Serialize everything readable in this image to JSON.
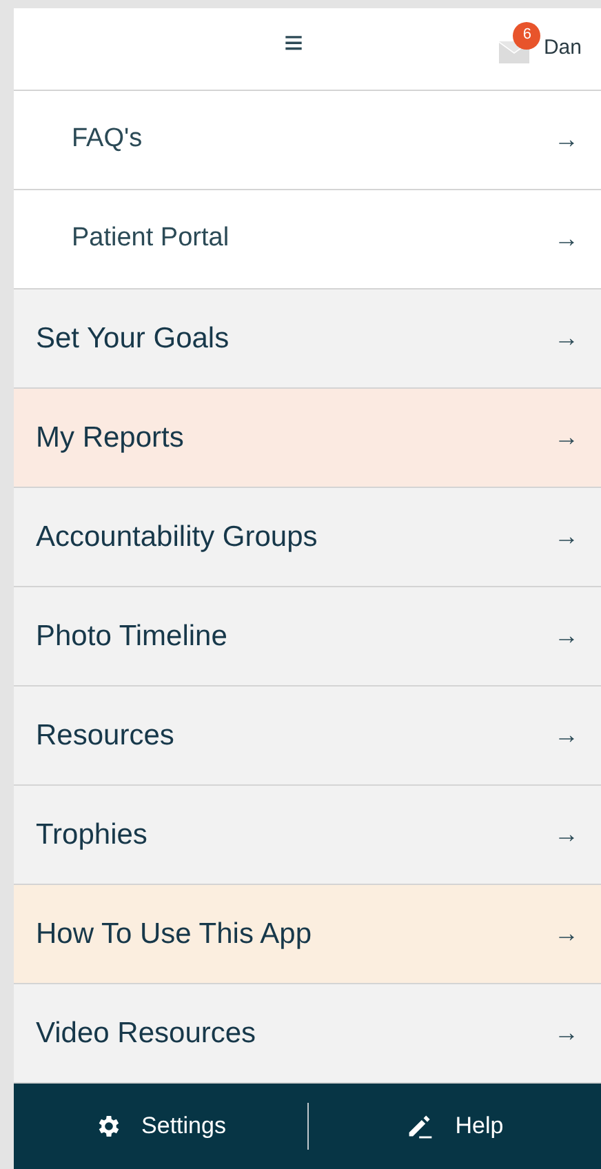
{
  "header": {
    "menu_label": "≡",
    "unread_count": "6",
    "user_name": "Dan"
  },
  "menu_items": [
    {
      "label": "FAQ's",
      "kind": "sub",
      "color": "#ffffff",
      "arrow": "→"
    },
    {
      "label": "Patient Portal",
      "kind": "sub",
      "color": "#ffffff",
      "arrow": "→"
    },
    {
      "label": "Set Your Goals",
      "kind": "main",
      "color": "#f2f2f2",
      "arrow": "→"
    },
    {
      "label": "My Reports",
      "kind": "main",
      "color": "#fbeae1",
      "arrow": "→"
    },
    {
      "label": "Accountability Groups",
      "kind": "main",
      "color": "#f2f2f2",
      "arrow": "→"
    },
    {
      "label": "Photo Timeline",
      "kind": "main",
      "color": "#f2f2f2",
      "arrow": "→"
    },
    {
      "label": "Resources",
      "kind": "main",
      "color": "#f2f2f2",
      "arrow": "→"
    },
    {
      "label": "Trophies",
      "kind": "main",
      "color": "#f2f2f2",
      "arrow": "→"
    },
    {
      "label": "How To Use This App",
      "kind": "main",
      "color": "#fbeedf",
      "arrow": "→"
    },
    {
      "label": "Video Resources",
      "kind": "main",
      "color": "#f2f2f2",
      "arrow": "→"
    }
  ],
  "footer": [
    {
      "label": "Settings",
      "kind": "settings"
    },
    {
      "label": "Help",
      "kind": "help"
    }
  ]
}
